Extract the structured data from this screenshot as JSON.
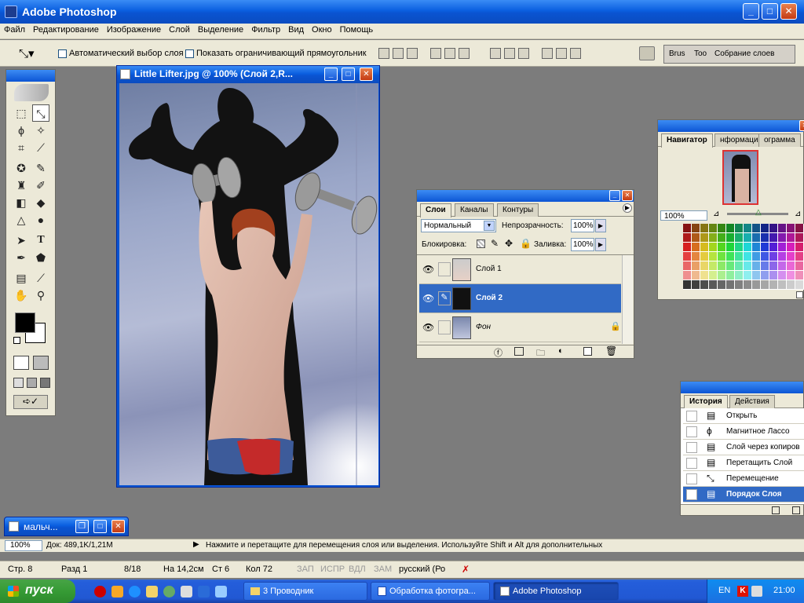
{
  "app": {
    "title": "Adobe Photoshop"
  },
  "menu": [
    "Файл",
    "Редактирование",
    "Изображение",
    "Слой",
    "Выделение",
    "Фильтр",
    "Вид",
    "Окно",
    "Помощь"
  ],
  "options": {
    "auto_select_label": "Автоматический выбор слоя",
    "show_bbox_label": "Показать ограничивающий прямоугольник",
    "well_tabs": [
      "Brus",
      "Too",
      "Собрание слоев"
    ]
  },
  "document": {
    "title": "Little Lifter.jpg @ 100% (Слой 2,R..."
  },
  "minimized_doc": {
    "title": "мальч..."
  },
  "navigator": {
    "tabs": [
      "Навигатор",
      "нформация",
      "ограмма"
    ],
    "zoom": "100%"
  },
  "layers": {
    "tabs": [
      "Слои",
      "Каналы",
      "Контуры"
    ],
    "blend_mode": "Нормальный",
    "opacity_label": "Непрозрачность:",
    "opacity": "100%",
    "lock_label": "Блокировка:",
    "fill_label": "Заливка:",
    "fill": "100%",
    "items": [
      {
        "name": "Слой 1",
        "selected": false
      },
      {
        "name": "Слой 2",
        "selected": true
      },
      {
        "name": "Фон",
        "selected": false
      }
    ]
  },
  "history": {
    "tabs": [
      "История",
      "Действия"
    ],
    "items": [
      {
        "name": "Открыть",
        "icon": "document-icon"
      },
      {
        "name": "Магнитное Лассо",
        "icon": "magnetic-lasso-icon"
      },
      {
        "name": "Слой через копиров",
        "icon": "document-icon"
      },
      {
        "name": "Перетащить Слой",
        "icon": "document-icon"
      },
      {
        "name": "Перемещение",
        "icon": "move-icon"
      },
      {
        "name": "Порядок Слоя",
        "icon": "document-icon"
      }
    ]
  },
  "status": {
    "zoom": "100%",
    "doc": "Док: 489,1K/1,21M",
    "hint": "Нажмите и перетащите для перемещения слоя или выделения. Используйте Shift и Alt для дополнительных"
  },
  "word_status": {
    "page": "Стр. 8",
    "section": "Разд 1",
    "pages": "8/18",
    "at": "На 14,2см",
    "line": "Ст 6",
    "col": "Кол 72",
    "rec": "ЗАП",
    "trk": "ИСПР",
    "ext": "ВДЛ",
    "ovr": "ЗАМ",
    "lang": "русский (Ро"
  },
  "taskbar": {
    "start": "пуск",
    "tasks": [
      "3 Проводник",
      "Обработка фотогра...",
      "Adobe Photoshop"
    ],
    "lang": "EN",
    "clock": "21:00"
  },
  "colors": {
    "xp_blue": "#0a54d2",
    "selection": "#316ac5",
    "panel": "#ece9d8"
  }
}
